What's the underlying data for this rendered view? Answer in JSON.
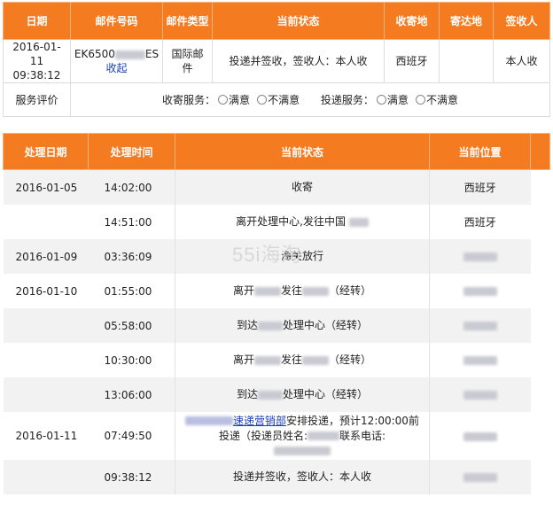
{
  "top_table": {
    "headers": [
      "日期",
      "邮件号码",
      "邮件类型",
      "当前状态",
      "收寄地",
      "寄达地",
      "签收人"
    ],
    "row": {
      "date_line1": "2016-01-",
      "date_line2": "11 09:38:12",
      "mail_no_prefix": "EK6500",
      "mail_no_suffix": "ES",
      "mail_link": "收起",
      "mail_type_line1": "国际邮",
      "mail_type_line2": "件",
      "status": "投递并签收，签收人：本人收",
      "origin": "西班牙",
      "destination": "",
      "signer": "本人收"
    },
    "service": {
      "label": "服务评价",
      "receive_label": "收寄服务：",
      "deliver_label": "投递服务：",
      "option_satisfied": "满意",
      "option_unsatisfied": "不满意"
    }
  },
  "tracking_table": {
    "headers": [
      "处理日期",
      "处理时间",
      "当前状态",
      "当前位置"
    ],
    "rows": [
      {
        "date": "2016-01-05",
        "time": "14:02:00",
        "status": "收寄",
        "location": "西班牙"
      },
      {
        "date": "",
        "time": "14:51:00",
        "status": "离开处理中心,发往中国",
        "location": "西班牙"
      },
      {
        "date": "2016-01-09",
        "time": "03:36:09",
        "status": "海关放行",
        "location": ""
      },
      {
        "date": "2016-01-10",
        "time": "01:55:00",
        "status_a": "离开",
        "status_b": "发往",
        "status_c": "（经转）",
        "location": ""
      },
      {
        "date": "",
        "time": "05:58:00",
        "status_a": "到达",
        "status_b": "处理中心（经转）",
        "location": ""
      },
      {
        "date": "",
        "time": "10:30:00",
        "status_a": "离开",
        "status_b": "发往",
        "status_c": "（经转）",
        "location": ""
      },
      {
        "date": "",
        "time": "13:06:00",
        "status_a": "到达",
        "status_b": "处理中心（经转）",
        "location": ""
      },
      {
        "date": "2016-01-11",
        "time": "07:49:50",
        "status_link": "速递营销部",
        "status_line1": "安排投递，预计12:00:00前",
        "status_line2a": "投递（投递员姓名:",
        "status_line2b": "联系电话:",
        "location": ""
      },
      {
        "date": "",
        "time": "09:38:12",
        "status": "投递并签收，签收人：本人收",
        "location": ""
      }
    ]
  },
  "watermark": "55i海淘"
}
